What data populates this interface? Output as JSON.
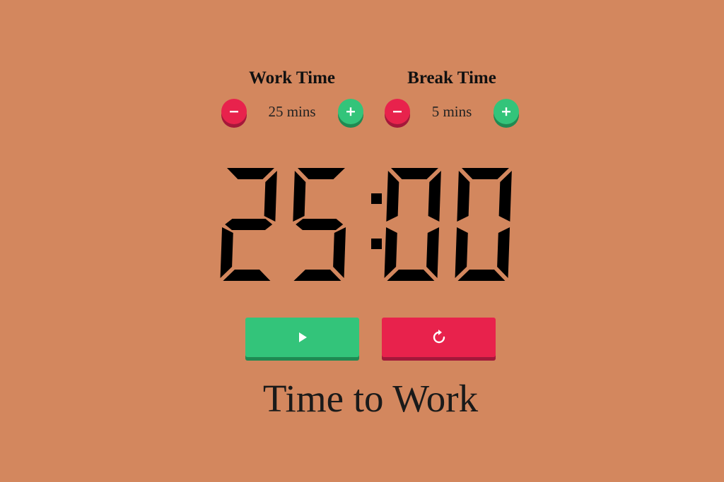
{
  "work": {
    "title": "Work Time",
    "value": "25 mins"
  },
  "break": {
    "title": "Break Time",
    "value": "5 mins"
  },
  "timer": {
    "display": "25:00"
  },
  "controls": {
    "start_icon": "play-icon",
    "reset_icon": "reset-icon"
  },
  "status": {
    "text": "Time to Work"
  },
  "colors": {
    "background": "#d3875e",
    "accent_green": "#33c47a",
    "accent_red": "#e8224c",
    "digit_color": "#000000"
  },
  "icons": {
    "minus": "minus-icon",
    "plus": "plus-icon"
  }
}
